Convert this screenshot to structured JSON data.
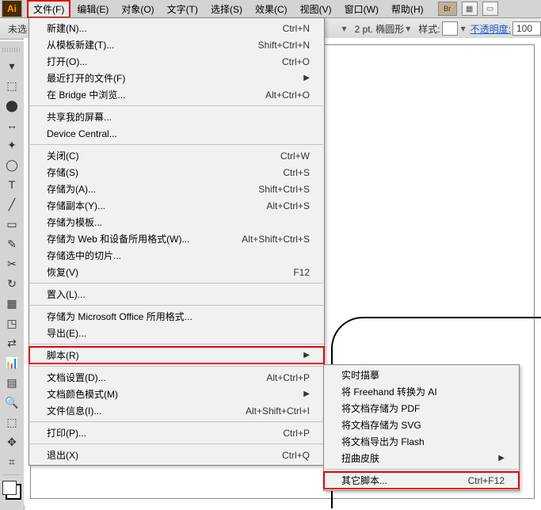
{
  "menubar": {
    "items": [
      "文件(F)",
      "编辑(E)",
      "对象(O)",
      "文字(T)",
      "选择(S)",
      "效果(C)",
      "视图(V)",
      "窗口(W)",
      "帮助(H)"
    ],
    "br_label": "Br"
  },
  "toolbar": {
    "prefix": "未选",
    "stroke_label": "2 pt. 椭圆形",
    "style_label": "样式:",
    "opacity_label": "不透明度:",
    "opacity_value": "100"
  },
  "file_menu": [
    {
      "label": "新建(N)...",
      "shortcut": "Ctrl+N"
    },
    {
      "label": "从模板新建(T)...",
      "shortcut": "Shift+Ctrl+N"
    },
    {
      "label": "打开(O)...",
      "shortcut": "Ctrl+O"
    },
    {
      "label": "最近打开的文件(F)",
      "submenu": true
    },
    {
      "label": "在 Bridge 中浏览...",
      "shortcut": "Alt+Ctrl+O"
    },
    {
      "sep": true
    },
    {
      "label": "共享我的屏幕..."
    },
    {
      "label": "Device Central..."
    },
    {
      "sep": true
    },
    {
      "label": "关闭(C)",
      "shortcut": "Ctrl+W"
    },
    {
      "label": "存储(S)",
      "shortcut": "Ctrl+S"
    },
    {
      "label": "存储为(A)...",
      "shortcut": "Shift+Ctrl+S"
    },
    {
      "label": "存储副本(Y)...",
      "shortcut": "Alt+Ctrl+S"
    },
    {
      "label": "存储为模板..."
    },
    {
      "label": "存储为 Web 和设备所用格式(W)...",
      "shortcut": "Alt+Shift+Ctrl+S"
    },
    {
      "label": "存储选中的切片..."
    },
    {
      "label": "恢复(V)",
      "shortcut": "F12"
    },
    {
      "sep": true
    },
    {
      "label": "置入(L)..."
    },
    {
      "sep": true
    },
    {
      "label": "存储为 Microsoft Office 所用格式..."
    },
    {
      "label": "导出(E)..."
    },
    {
      "sep": true
    },
    {
      "label": "脚本(R)",
      "submenu": true,
      "highlight": true
    },
    {
      "sep": true
    },
    {
      "label": "文档设置(D)...",
      "shortcut": "Alt+Ctrl+P"
    },
    {
      "label": "文档颜色模式(M)",
      "submenu": true
    },
    {
      "label": "文件信息(I)...",
      "shortcut": "Alt+Shift+Ctrl+I"
    },
    {
      "sep": true
    },
    {
      "label": "打印(P)...",
      "shortcut": "Ctrl+P"
    },
    {
      "sep": true
    },
    {
      "label": "退出(X)",
      "shortcut": "Ctrl+Q"
    }
  ],
  "script_submenu": [
    {
      "label": "实时描摹"
    },
    {
      "label": "将 Freehand 转换为 AI"
    },
    {
      "label": "将文档存储为 PDF"
    },
    {
      "label": "将文档存储为 SVG"
    },
    {
      "label": "将文档导出为 Flash"
    },
    {
      "label": "扭曲皮肤",
      "submenu": true
    },
    {
      "sep": true
    },
    {
      "label": "其它脚本...",
      "shortcut": "Ctrl+F12",
      "highlight": true
    }
  ],
  "tools": [
    "▾",
    "⬚",
    "⬤",
    "↔",
    "✦",
    "◯",
    "T",
    "╱",
    "▭",
    "✎",
    "✂",
    "↻",
    "▦",
    "◳",
    "⇄",
    "📊",
    "▤",
    "🔍",
    "⬚",
    "✥",
    "⌗"
  ]
}
